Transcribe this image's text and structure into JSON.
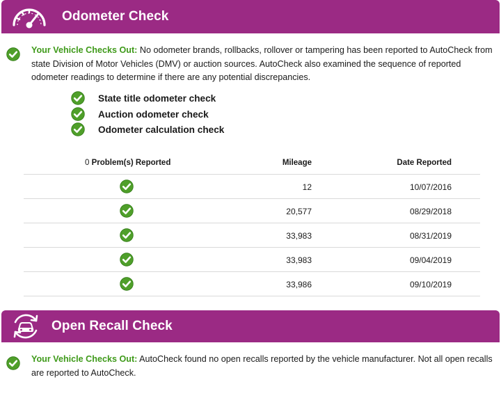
{
  "odometer": {
    "title": "Odometer Check",
    "status_label": "Your Vehicle Checks Out:",
    "status_text": " No odometer brands, rollbacks, rollover or tampering has been reported to AutoCheck from state Division of Motor Vehicles (DMV) or auction sources. AutoCheck also examined the sequence of reported odometer readings to determine if there are any potential discrepancies.",
    "checks": [
      {
        "label": "State title odometer check"
      },
      {
        "label": "Auction odometer check"
      },
      {
        "label": "Odometer calculation check"
      }
    ],
    "table": {
      "header_count": "0",
      "header_problems": "Problem(s) Reported",
      "header_mileage": "Mileage",
      "header_date": "Date Reported",
      "rows": [
        {
          "mileage": "12",
          "date": "10/07/2016"
        },
        {
          "mileage": "20,577",
          "date": "08/29/2018"
        },
        {
          "mileage": "33,983",
          "date": "08/31/2019"
        },
        {
          "mileage": "33,983",
          "date": "09/04/2019"
        },
        {
          "mileage": "33,986",
          "date": "09/10/2019"
        }
      ]
    }
  },
  "recall": {
    "title": "Open Recall Check",
    "status_label": "Your Vehicle Checks Out:",
    "status_text": " AutoCheck found no open recalls reported by the vehicle manufacturer. Not all open recalls are reported to AutoCheck."
  },
  "colors": {
    "banner": "#9b2a84",
    "ok_green": "#3f9a1a",
    "check_fill": "#4f9f2a"
  },
  "icons": {
    "odometer": "speedometer-icon",
    "recall": "car-recall-icon",
    "check": "check-circle-icon"
  }
}
